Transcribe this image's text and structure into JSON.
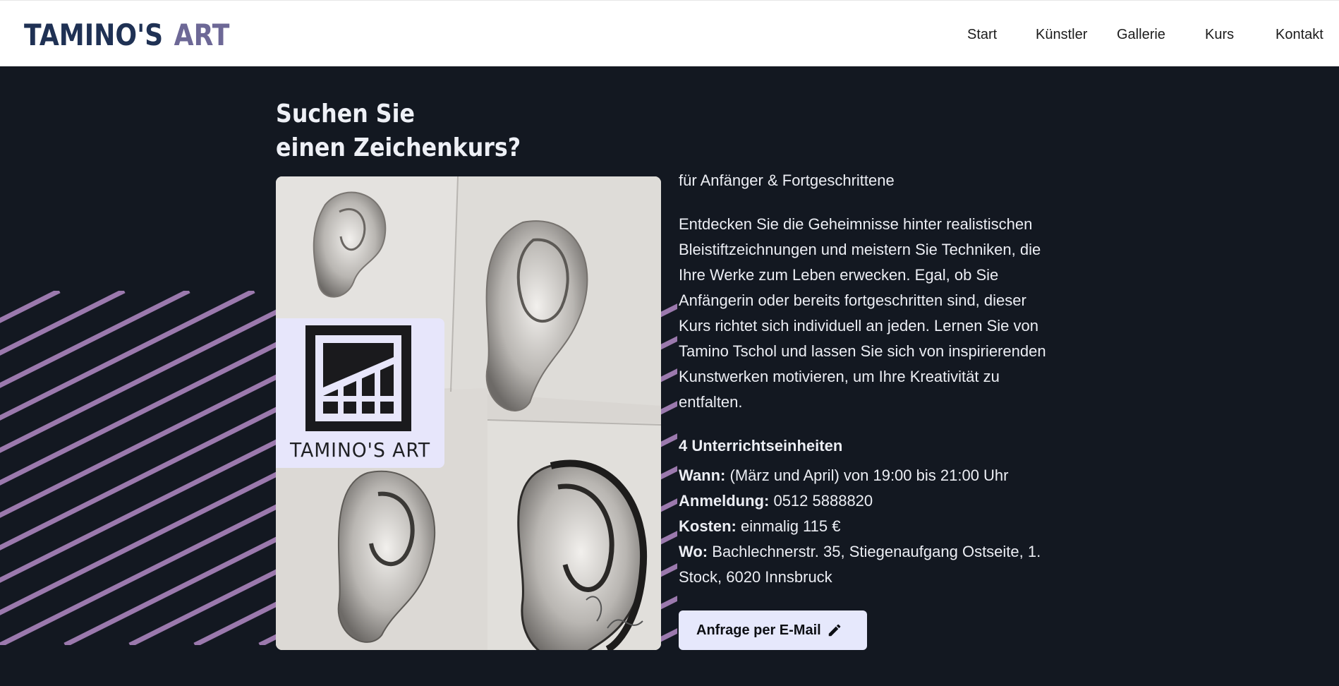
{
  "header": {
    "logo_part1": "TAMINO'S",
    "logo_part2": "ART",
    "nav": [
      {
        "label": "Start"
      },
      {
        "label": "Künstler"
      },
      {
        "label": "Gallerie"
      },
      {
        "label": "Kurs"
      },
      {
        "label": "Kontakt"
      }
    ]
  },
  "hero": {
    "title_line1": "Suchen Sie",
    "title_line2": "einen Zeichenkurs?",
    "image_description_icon": "ear-drawings-photo",
    "logo_card_text": "TAMINO'S ART"
  },
  "course": {
    "subtitle": "für Anfänger & Fortgeschrittene",
    "description": "Entdecken Sie die Geheimnisse hinter realistischen Bleistiftzeichnungen und meistern Sie Techniken, die Ihre Werke zum Leben erwecken. Egal, ob Sie Anfängerin oder bereits fortgeschritten sind, dieser Kurs richtet sich individuell an jeden. Lernen Sie von Tamino Tschol und lassen Sie sich von inspirierenden Kunstwerken motivieren, um Ihre Kreativität zu entfalten.",
    "units": "4 Unterrichtseinheiten",
    "when_label": "Wann:",
    "when_value": "(März und April) von 19:00 bis 21:00 Uhr",
    "signup_label": "Anmeldung:",
    "signup_value": "0512 5888820",
    "cost_label": "Kosten:",
    "cost_value": "einmalig 115 €",
    "where_label": "Wo:",
    "where_value": "Bachlechnerstr. 35, Stiegenaufgang Ostseite, 1. Stock, 6020 Innsbruck",
    "cta_label": "Anfrage per E-Mail",
    "cta_icon": "pencil-icon"
  },
  "colors": {
    "background": "#131821",
    "logo_dark": "#1f3154",
    "logo_accent": "#6d6896",
    "stripe": "#9b79ad",
    "cta_bg": "#e6e8fc"
  }
}
